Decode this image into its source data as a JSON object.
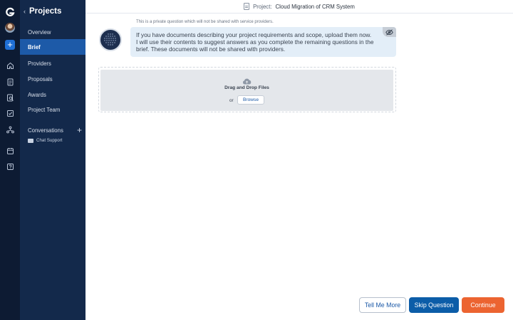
{
  "rail": {
    "icons": [
      "logo-icon",
      "avatar",
      "add-icon",
      "home-icon",
      "document-icon",
      "search-document-icon",
      "checklist-icon",
      "network-icon",
      "calendar-icon",
      "help-icon"
    ]
  },
  "nav": {
    "back_title": "Projects",
    "items": [
      {
        "label": "Overview"
      },
      {
        "label": "Brief"
      },
      {
        "label": "Providers"
      },
      {
        "label": "Proposals"
      },
      {
        "label": "Awards"
      },
      {
        "label": "Project Team"
      }
    ],
    "active_index": 1,
    "conversations_label": "Conversations",
    "chat_support_label": "Chat Support"
  },
  "header": {
    "prefix": "Project:",
    "project_name": "Cloud Migration of CRM System"
  },
  "message": {
    "private_note": "This is a private question which will not be shared with service providers.",
    "lines": [
      "If you have documents describing your project requirements and scope, upload them now.",
      "I will use their contents to suggest answers as you complete the remaining questions in the",
      "brief. These documents will not be shared with providers."
    ]
  },
  "upload": {
    "drag_label": "Drag and Drop Files",
    "or_label": "or",
    "browse_label": "Browse"
  },
  "footer": {
    "tell_more_label": "Tell Me More",
    "skip_label": "Skip Question",
    "continue_label": "Continue"
  },
  "colors": {
    "rail_bg": "#0d1b33",
    "nav_bg": "#13294b",
    "nav_active": "#1d5aa8",
    "bubble_bg": "#e3eef8",
    "primary": "#0c5da8",
    "accent": "#ec6431"
  }
}
